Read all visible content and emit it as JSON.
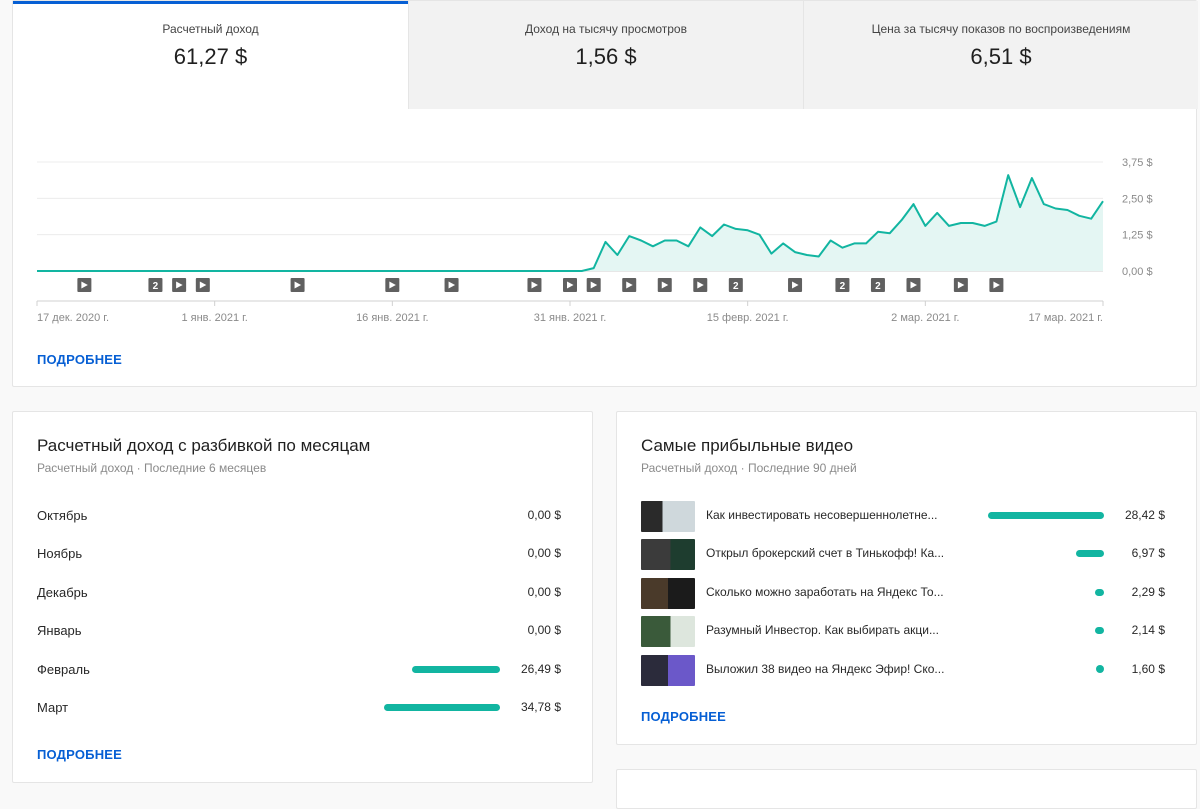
{
  "tabs": [
    {
      "label": "Расчетный доход",
      "value": "61,27 $"
    },
    {
      "label": "Доход на тысячу просмотров",
      "value": "1,56 $"
    },
    {
      "label": "Цена за тысячу показов по воспроизведениям",
      "value": "6,51 $"
    }
  ],
  "chart_data": {
    "type": "area",
    "y_ticks": [
      "3,75 $",
      "2,50 $",
      "1,25 $",
      "0,00 $"
    ],
    "ylim": [
      0,
      3.75
    ],
    "x_ticks": [
      {
        "label": "17 дек. 2020 г.",
        "day": 0
      },
      {
        "label": "1 янв. 2021 г.",
        "day": 15
      },
      {
        "label": "16 янв. 2021 г.",
        "day": 30
      },
      {
        "label": "31 янв. 2021 г.",
        "day": 45
      },
      {
        "label": "15 февр. 2021 г.",
        "day": 60
      },
      {
        "label": "2 мар. 2021 г.",
        "day": 75
      },
      {
        "label": "17 мар. 2021 г.",
        "day": 90
      }
    ],
    "values": [
      0,
      0,
      0,
      0,
      0,
      0,
      0,
      0,
      0,
      0,
      0,
      0,
      0,
      0,
      0,
      0,
      0,
      0,
      0,
      0,
      0,
      0,
      0,
      0,
      0,
      0,
      0,
      0,
      0,
      0,
      0,
      0,
      0,
      0,
      0,
      0,
      0,
      0,
      0,
      0,
      0,
      0,
      0,
      0,
      0,
      0,
      0,
      0.1,
      1.0,
      0.55,
      1.2,
      1.05,
      0.85,
      1.05,
      1.05,
      0.85,
      1.5,
      1.2,
      1.6,
      1.45,
      1.4,
      1.25,
      0.6,
      0.95,
      0.65,
      0.55,
      0.5,
      1.05,
      0.8,
      0.95,
      0.95,
      1.35,
      1.3,
      1.75,
      2.3,
      1.55,
      2.0,
      1.55,
      1.65,
      1.65,
      1.55,
      1.7,
      3.3,
      2.2,
      3.2,
      2.3,
      2.15,
      2.1,
      1.9,
      1.8,
      2.4
    ],
    "markers": [
      {
        "day": 4,
        "type": "video"
      },
      {
        "day": 10,
        "type": "count",
        "label": "2"
      },
      {
        "day": 12,
        "type": "video"
      },
      {
        "day": 14,
        "type": "video"
      },
      {
        "day": 22,
        "type": "video"
      },
      {
        "day": 30,
        "type": "video"
      },
      {
        "day": 35,
        "type": "video"
      },
      {
        "day": 42,
        "type": "video"
      },
      {
        "day": 45,
        "type": "video"
      },
      {
        "day": 47,
        "type": "video"
      },
      {
        "day": 50,
        "type": "video"
      },
      {
        "day": 53,
        "type": "video"
      },
      {
        "day": 56,
        "type": "video"
      },
      {
        "day": 59,
        "type": "count",
        "label": "2"
      },
      {
        "day": 64,
        "type": "video"
      },
      {
        "day": 68,
        "type": "count",
        "label": "2"
      },
      {
        "day": 71,
        "type": "count",
        "label": "2"
      },
      {
        "day": 74,
        "type": "video"
      },
      {
        "day": 78,
        "type": "video"
      },
      {
        "day": 81,
        "type": "video"
      }
    ],
    "colors": {
      "line": "#12b5a1",
      "fill": "#e4f6f3",
      "marker": "#606060"
    }
  },
  "main_link": "ПОДРОБНЕЕ",
  "months": {
    "title": "Расчетный доход с разбивкой по месяцам",
    "subtitle": "Расчетный доход · Последние 6 месяцев",
    "rows": [
      {
        "label": "Октябрь",
        "value": "0,00 $",
        "amount": 0
      },
      {
        "label": "Ноябрь",
        "value": "0,00 $",
        "amount": 0
      },
      {
        "label": "Декабрь",
        "value": "0,00 $",
        "amount": 0
      },
      {
        "label": "Январь",
        "value": "0,00 $",
        "amount": 0
      },
      {
        "label": "Февраль",
        "value": "26,49 $",
        "amount": 26.49
      },
      {
        "label": "Март",
        "value": "34,78 $",
        "amount": 34.78
      }
    ],
    "link": "ПОДРОБНЕЕ"
  },
  "videos": {
    "title": "Самые прибыльные видео",
    "subtitle": "Расчетный доход · Последние 90 дней",
    "rows": [
      {
        "title": "Как инвестировать несовершеннолетне...",
        "value": "28,42 $",
        "amount": 28.42
      },
      {
        "title": "Открыл брокерский счет в Тинькофф! Ка...",
        "value": "6,97 $",
        "amount": 6.97
      },
      {
        "title": "Сколько можно заработать на Яндекс То...",
        "value": "2,29 $",
        "amount": 2.29
      },
      {
        "title": "Разумный Инвестор. Как выбирать акци...",
        "value": "2,14 $",
        "amount": 2.14
      },
      {
        "title": "Выложил 38 видео на Яндекс Эфир! Ско...",
        "value": "1,60 $",
        "amount": 1.6
      }
    ],
    "link": "ПОДРОБНЕЕ"
  },
  "colors": {
    "accent": "#065fd4",
    "bar": "#12b5a1"
  },
  "icons": {
    "video_marker": "play-icon",
    "count_marker": "video-count-badge"
  }
}
